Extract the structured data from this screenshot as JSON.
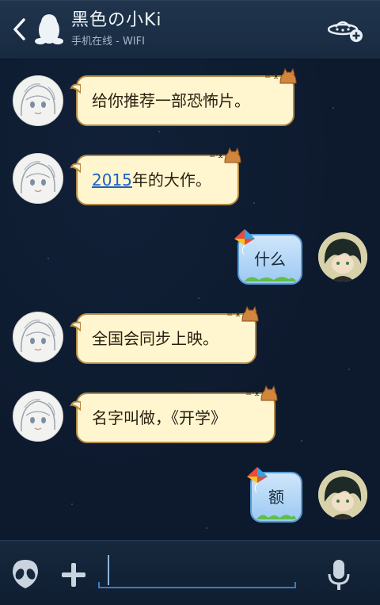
{
  "header": {
    "title": "黑色の小Ki",
    "status": "手机在线 - WIFI"
  },
  "messages": [
    {
      "side": "left",
      "text": "给你推荐一部恐怖片。"
    },
    {
      "side": "left",
      "link": "2015",
      "text": "年的大作。"
    },
    {
      "side": "right",
      "text": "什么"
    },
    {
      "side": "left",
      "text": "全国会同步上映。"
    },
    {
      "side": "left",
      "text": "名字叫做，《开学》"
    },
    {
      "side": "right",
      "text": "额"
    }
  ],
  "colors": {
    "header_bg": "#1b2f46",
    "chat_bg": "#0d1a2e",
    "left_bubble_bg": "#fff6cf",
    "left_bubble_border": "#b48a45",
    "right_bubble_bg": "#9cc9f2",
    "right_bubble_border": "#5b9ad2",
    "link": "#1b5fc7",
    "input_accent": "#3a7cc2"
  },
  "icons": {
    "back": "chevron-left-icon",
    "contact": "qq-penguin-icon",
    "ufo": "ufo-plus-icon",
    "emoji": "alien-icon",
    "more": "plus-icon",
    "voice": "microphone-icon"
  },
  "input": {
    "value": ""
  }
}
